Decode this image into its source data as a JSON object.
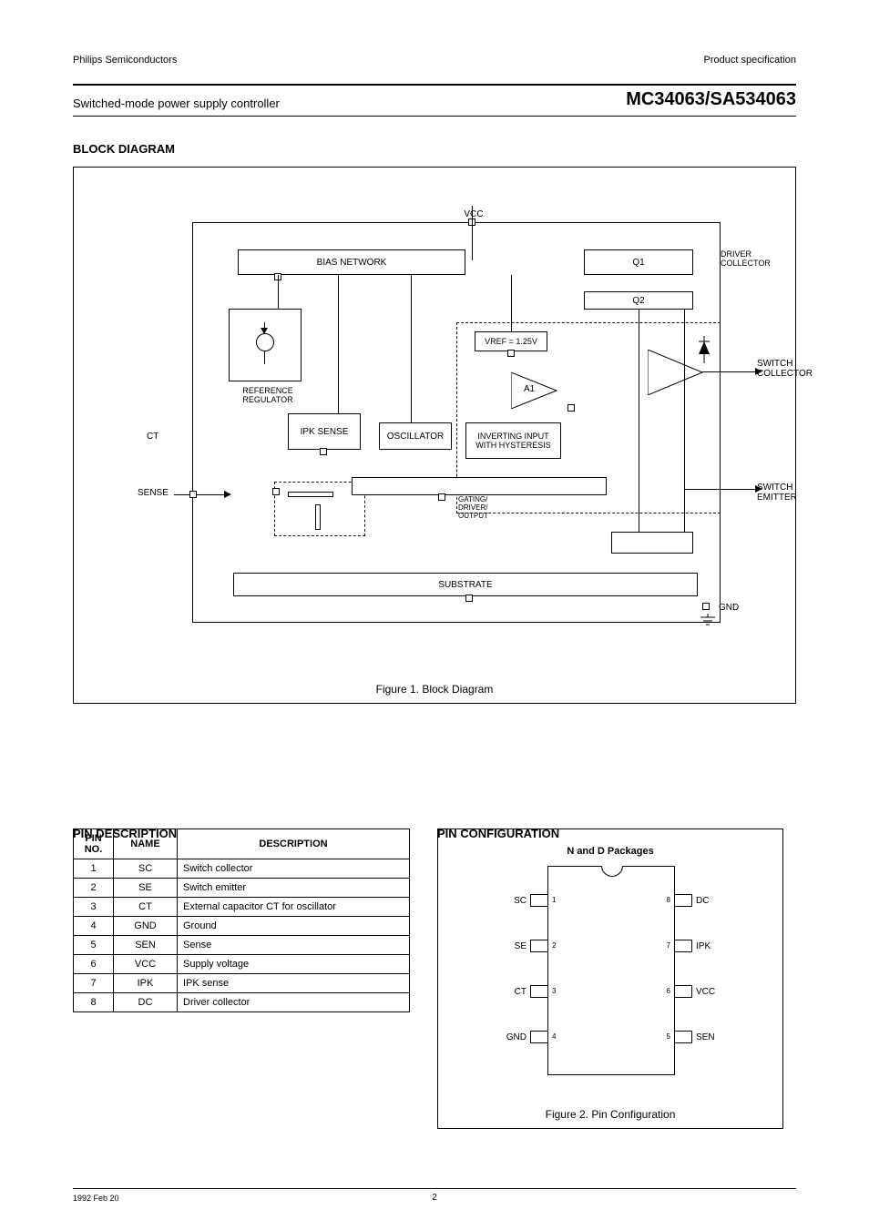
{
  "header": {
    "product_family": "Philips Semiconductors",
    "doc_type": "Product specification",
    "title": "Switched-mode power supply controller",
    "part": "MC34063/SA534063"
  },
  "sections": {
    "block_diagram_title": "BLOCK DIAGRAM",
    "pin_desc_title": "PIN DESCRIPTION",
    "pin_config_title": "PIN CONFIGURATION"
  },
  "block": {
    "vcc": "VCC",
    "b1": "BIAS NETWORK",
    "b2": "IPK SENSE",
    "b3": "REFERENCE REGULATOR",
    "vref": "VREF = 1.25V",
    "b4": "OSCILLATOR",
    "b5": "INVERTING INPUT WITH HYSTERESIS",
    "amp": "A1",
    "sub": "SUBSTRATE",
    "pin_ct": "CT",
    "pin_vcc": "VCC",
    "pin_sc": "SWITCH COLLECTOR",
    "pin_se": "SWITCH EMITTER",
    "pin_dc": "DRIVER COLLECTOR",
    "pin_sense": "SENSE",
    "pin_gnd": "GND",
    "q1": "Q1",
    "q2": "Q2",
    "gate": "GATING/\nDRIVER/\nOUTPUT",
    "figcap": "Figure 1.  Block Diagram"
  },
  "pin_table": {
    "headers": [
      "PIN NO.",
      "NAME",
      "DESCRIPTION"
    ],
    "rows": [
      [
        "1",
        "SC",
        "Switch collector"
      ],
      [
        "2",
        "SE",
        "Switch emitter"
      ],
      [
        "3",
        "CT",
        "External capacitor CT for oscillator"
      ],
      [
        "4",
        "GND",
        "Ground"
      ],
      [
        "5",
        "SEN",
        "Sense"
      ],
      [
        "6",
        "VCC",
        "Supply voltage"
      ],
      [
        "7",
        "IPK",
        "IPK sense"
      ],
      [
        "8",
        "DC",
        "Driver collector"
      ]
    ]
  },
  "pinout": {
    "package": "N and D Packages",
    "left": [
      "SC",
      "SE",
      "CT",
      "GND"
    ],
    "right": [
      "DC",
      "IPK",
      "VCC",
      "SEN"
    ],
    "left_nums": [
      "1",
      "2",
      "3",
      "4"
    ],
    "right_nums": [
      "8",
      "7",
      "6",
      "5"
    ],
    "figcap": "Figure 2.  Pin Configuration"
  },
  "footer": {
    "date": "1992 Feb 20",
    "page": "2"
  }
}
